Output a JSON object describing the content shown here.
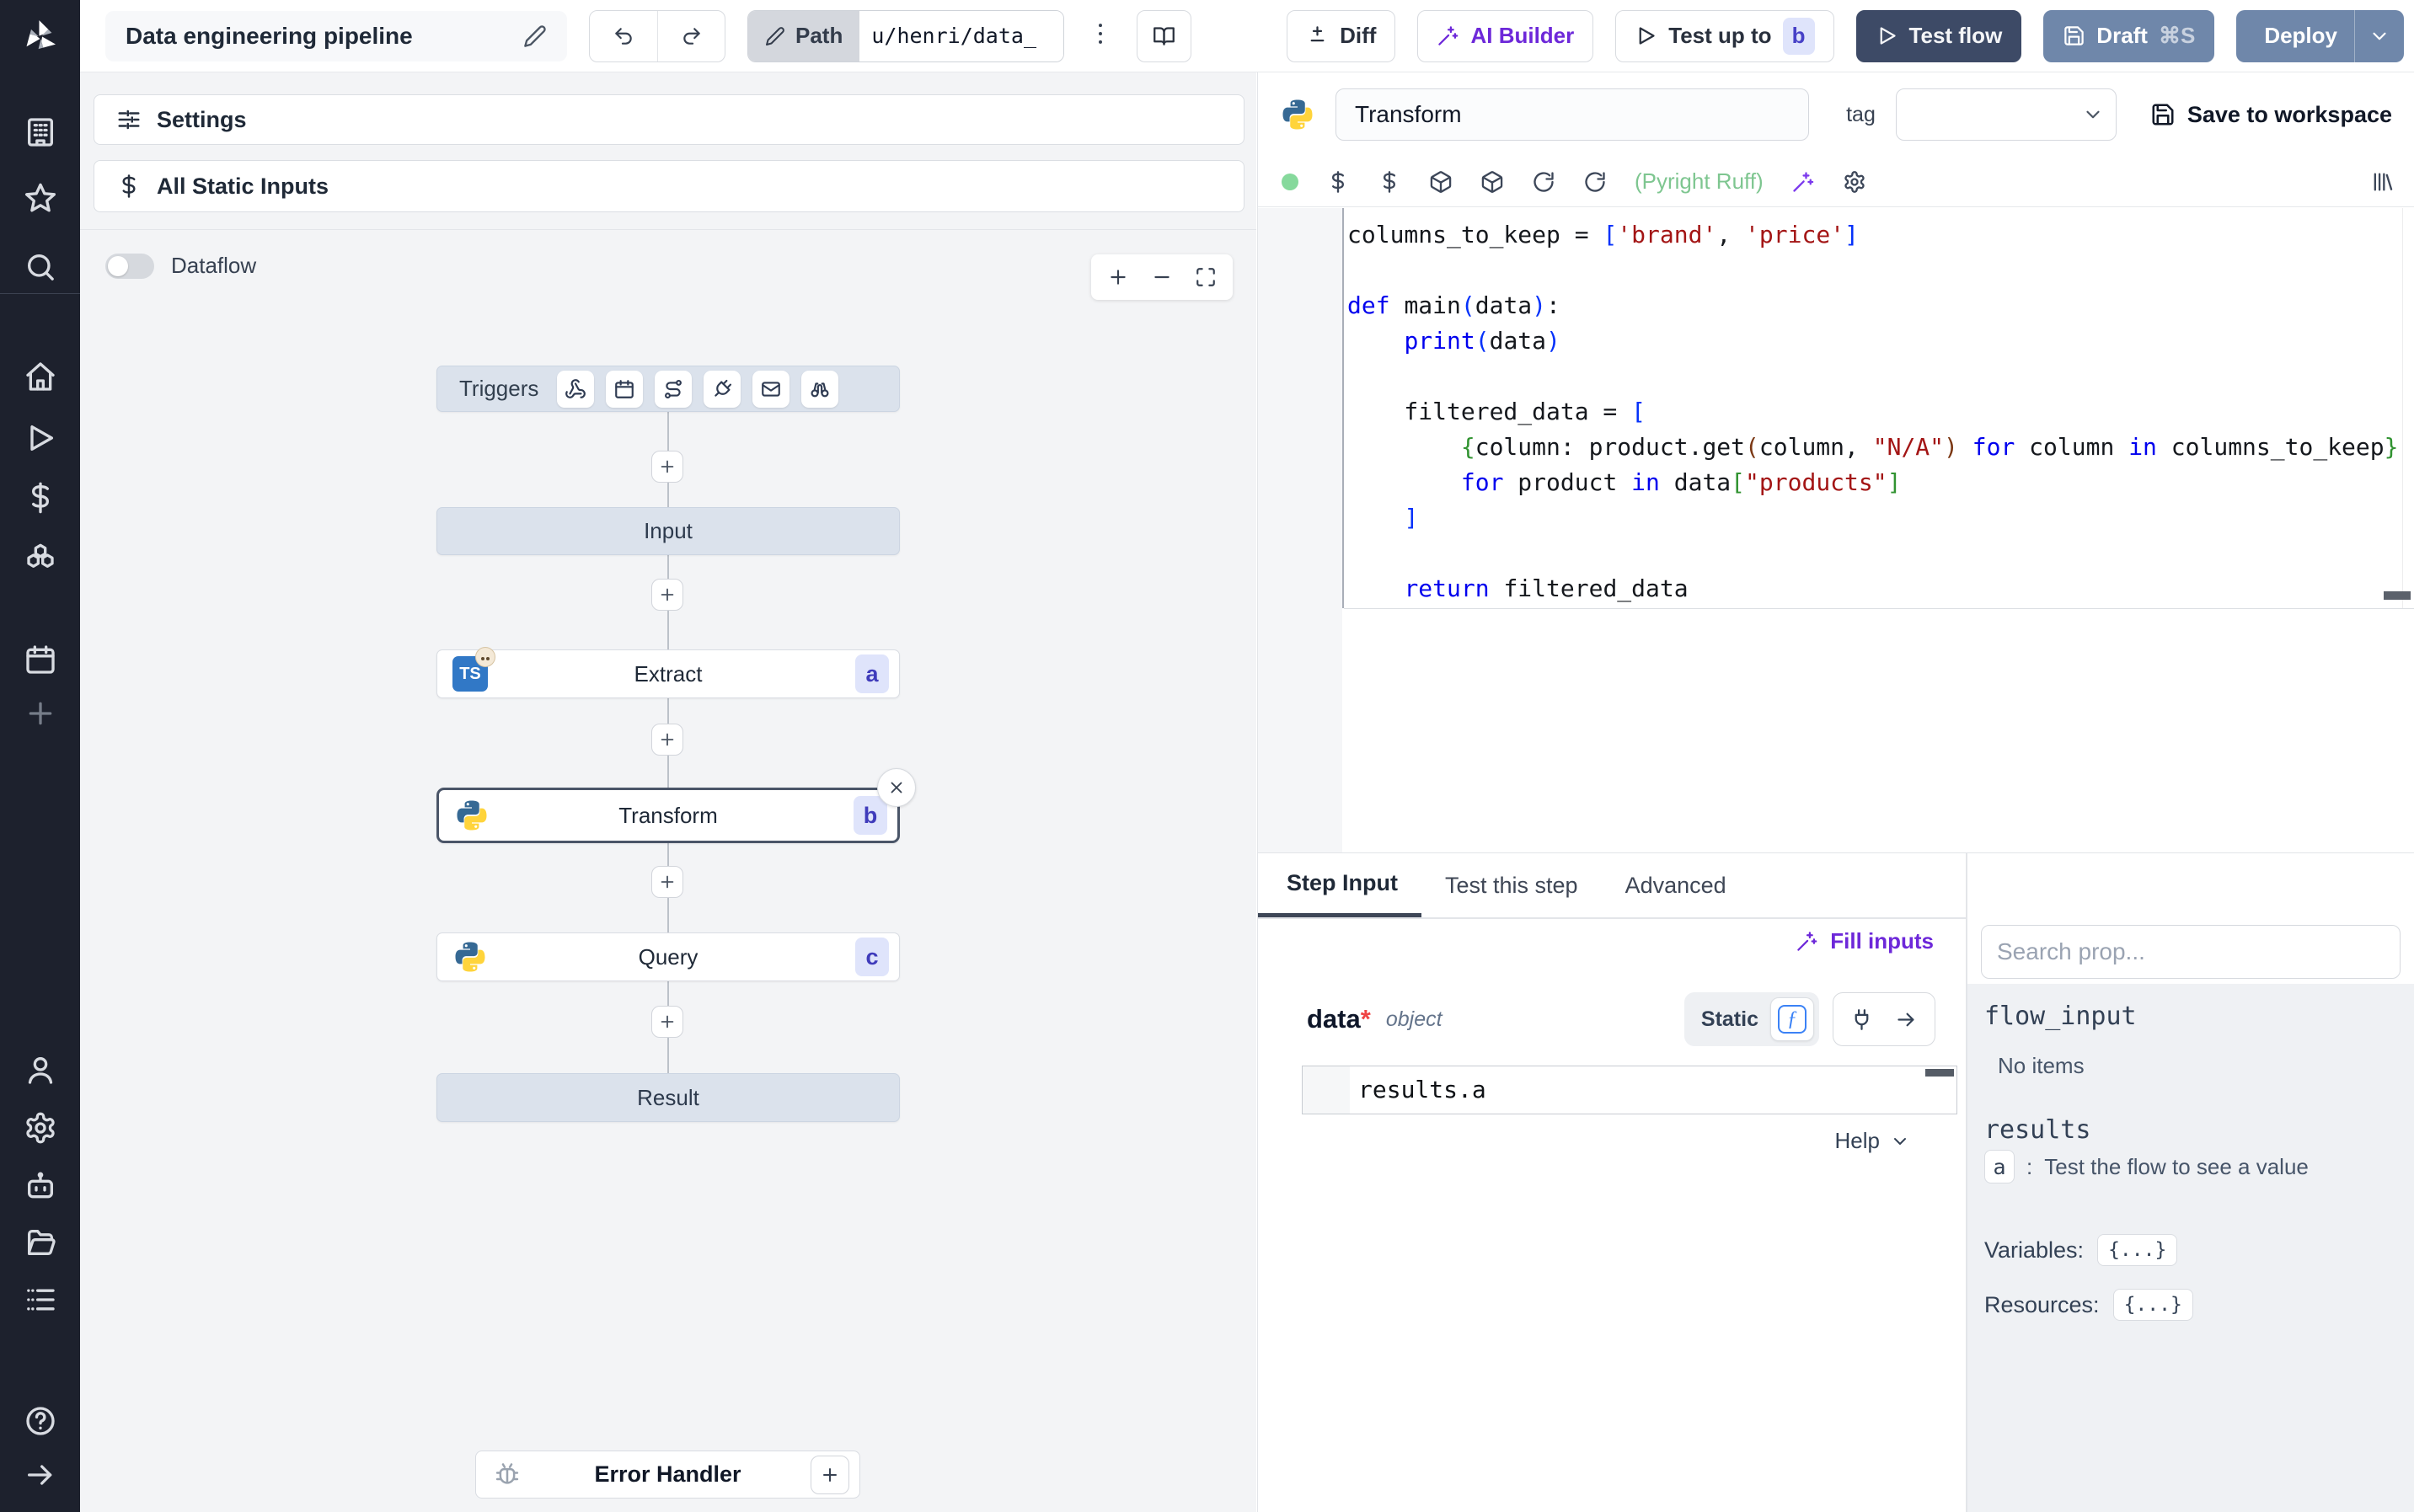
{
  "topbar": {
    "title": "Data engineering pipeline",
    "path_label": "Path",
    "path_value": "u/henri/data_",
    "diff_label": "Diff",
    "ai_builder_label": "AI Builder",
    "test_up_to_label": "Test up to",
    "test_up_to_badge": "b",
    "test_flow_label": "Test flow",
    "draft_label": "Draft",
    "draft_shortcut": "⌘S",
    "deploy_label": "Deploy"
  },
  "flow": {
    "settings_label": "Settings",
    "static_inputs_label": "All Static Inputs",
    "dataflow_label": "Dataflow",
    "triggers_label": "Triggers",
    "triggers_icons": [
      "webhook-icon",
      "schedule-icon",
      "route-icon",
      "plug-icon",
      "email-icon",
      "poll-icon"
    ],
    "nodes": {
      "input": "Input",
      "extract": "Extract",
      "extract_badge": "a",
      "transform": "Transform",
      "transform_badge": "b",
      "query": "Query",
      "query_badge": "c",
      "result": "Result",
      "error_handler": "Error Handler"
    }
  },
  "editor": {
    "step_name": "Transform",
    "tag_label": "tag",
    "save_label": "Save to workspace",
    "lint": "(Pyright Ruff)",
    "tabs": [
      "Step Input",
      "Test this step",
      "Advanced"
    ],
    "code": {
      "language": "python",
      "lines": [
        [
          {
            "t": "columns_to_keep = ",
            "c": "d"
          },
          {
            "t": "[",
            "c": "b1"
          },
          {
            "t": "'brand'",
            "c": "s"
          },
          {
            "t": ", ",
            "c": "d"
          },
          {
            "t": "'price'",
            "c": "s"
          },
          {
            "t": "]",
            "c": "b1"
          }
        ],
        [],
        [
          {
            "t": "def ",
            "c": "k"
          },
          {
            "t": "main",
            "c": "d"
          },
          {
            "t": "(",
            "c": "b1"
          },
          {
            "t": "data",
            "c": "d"
          },
          {
            "t": ")",
            "c": "b1"
          },
          {
            "t": ":",
            "c": "d"
          }
        ],
        [
          {
            "t": "    ",
            "c": "d"
          },
          {
            "t": "print",
            "c": "k"
          },
          {
            "t": "(",
            "c": "b1"
          },
          {
            "t": "data",
            "c": "d"
          },
          {
            "t": ")",
            "c": "b1"
          }
        ],
        [],
        [
          {
            "t": "    filtered_data = ",
            "c": "d"
          },
          {
            "t": "[",
            "c": "b1"
          }
        ],
        [
          {
            "t": "        ",
            "c": "d"
          },
          {
            "t": "{",
            "c": "b2"
          },
          {
            "t": "column: product.get",
            "c": "d"
          },
          {
            "t": "(",
            "c": "b3"
          },
          {
            "t": "column, ",
            "c": "d"
          },
          {
            "t": "\"N/A\"",
            "c": "s"
          },
          {
            "t": ")",
            "c": "b3"
          },
          {
            "t": " ",
            "c": "d"
          },
          {
            "t": "for",
            "c": "k"
          },
          {
            "t": " column ",
            "c": "d"
          },
          {
            "t": "in",
            "c": "k"
          },
          {
            "t": " columns_to_keep",
            "c": "d"
          },
          {
            "t": "}",
            "c": "b2"
          }
        ],
        [
          {
            "t": "        ",
            "c": "d"
          },
          {
            "t": "for",
            "c": "k"
          },
          {
            "t": " product ",
            "c": "d"
          },
          {
            "t": "in",
            "c": "k"
          },
          {
            "t": " data",
            "c": "d"
          },
          {
            "t": "[",
            "c": "b2"
          },
          {
            "t": "\"products\"",
            "c": "s"
          },
          {
            "t": "]",
            "c": "b2"
          }
        ],
        [
          {
            "t": "    ",
            "c": "d"
          },
          {
            "t": "]",
            "c": "b1"
          }
        ],
        [],
        [
          {
            "t": "    ",
            "c": "d"
          },
          {
            "t": "return",
            "c": "k"
          },
          {
            "t": " filtered_data",
            "c": "d"
          }
        ]
      ]
    }
  },
  "step_input": {
    "fill_inputs_label": "Fill inputs",
    "field_name": "data",
    "required_mark": "*",
    "field_type": "object",
    "static_label": "Static",
    "expression": "results.a",
    "help_label": "Help"
  },
  "props": {
    "search_placeholder": "Search prop...",
    "flow_input_label": "flow_input",
    "no_items": "No items",
    "results_label": "results",
    "result_key": "a",
    "result_sep": ":",
    "result_hint": "Test the flow to see a value",
    "variables_label": "Variables:",
    "variables_value": "{...}",
    "resources_label": "Resources:",
    "resources_value": "{...}"
  },
  "colors": {
    "accent_purple": "#6d28d9",
    "primary_dark": "#3d4a66",
    "secondary_slate": "#6f87aa",
    "badge_bg": "#dfe4fb",
    "badge_text": "#3f3bbb",
    "status_green": "#86d99c",
    "lint_green": "#7ec690",
    "node_virtual_bg": "#dbe2ec",
    "sidebar_bg": "#1d212d"
  }
}
